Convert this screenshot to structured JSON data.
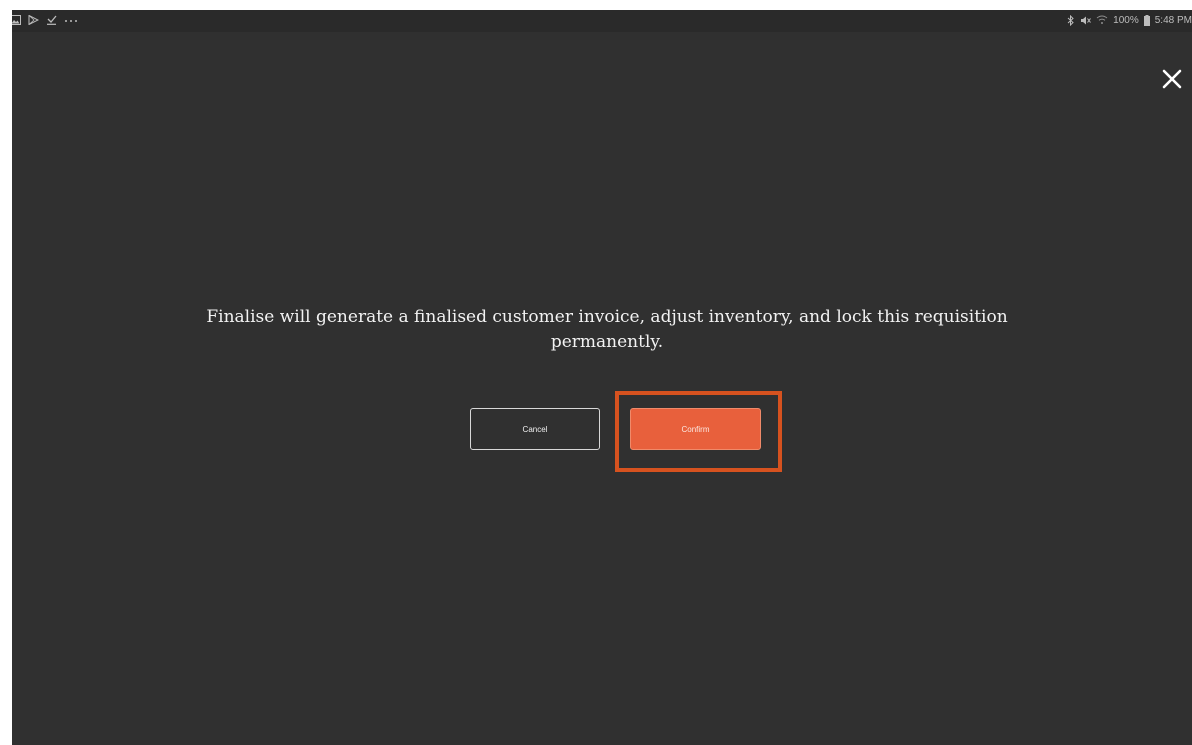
{
  "status_bar": {
    "left_icons": [
      "gallery-icon",
      "play-store-icon",
      "download-done-icon",
      "more-dots-icon"
    ],
    "right_icons": [
      "bluetooth-icon",
      "mute-icon",
      "wifi-icon",
      "battery-icon"
    ],
    "battery_text": "100%",
    "time": "5:48 PM"
  },
  "dialog": {
    "close_icon": "close-icon",
    "message": "Finalise will generate a finalised customer invoice, adjust inventory, and lock this requisition permanently.",
    "cancel_label": "Cancel",
    "confirm_label": "Confirm"
  },
  "colors": {
    "background": "#303030",
    "confirm": "#e8603c",
    "highlight": "#d6521f",
    "text": "#f2f2f2"
  }
}
